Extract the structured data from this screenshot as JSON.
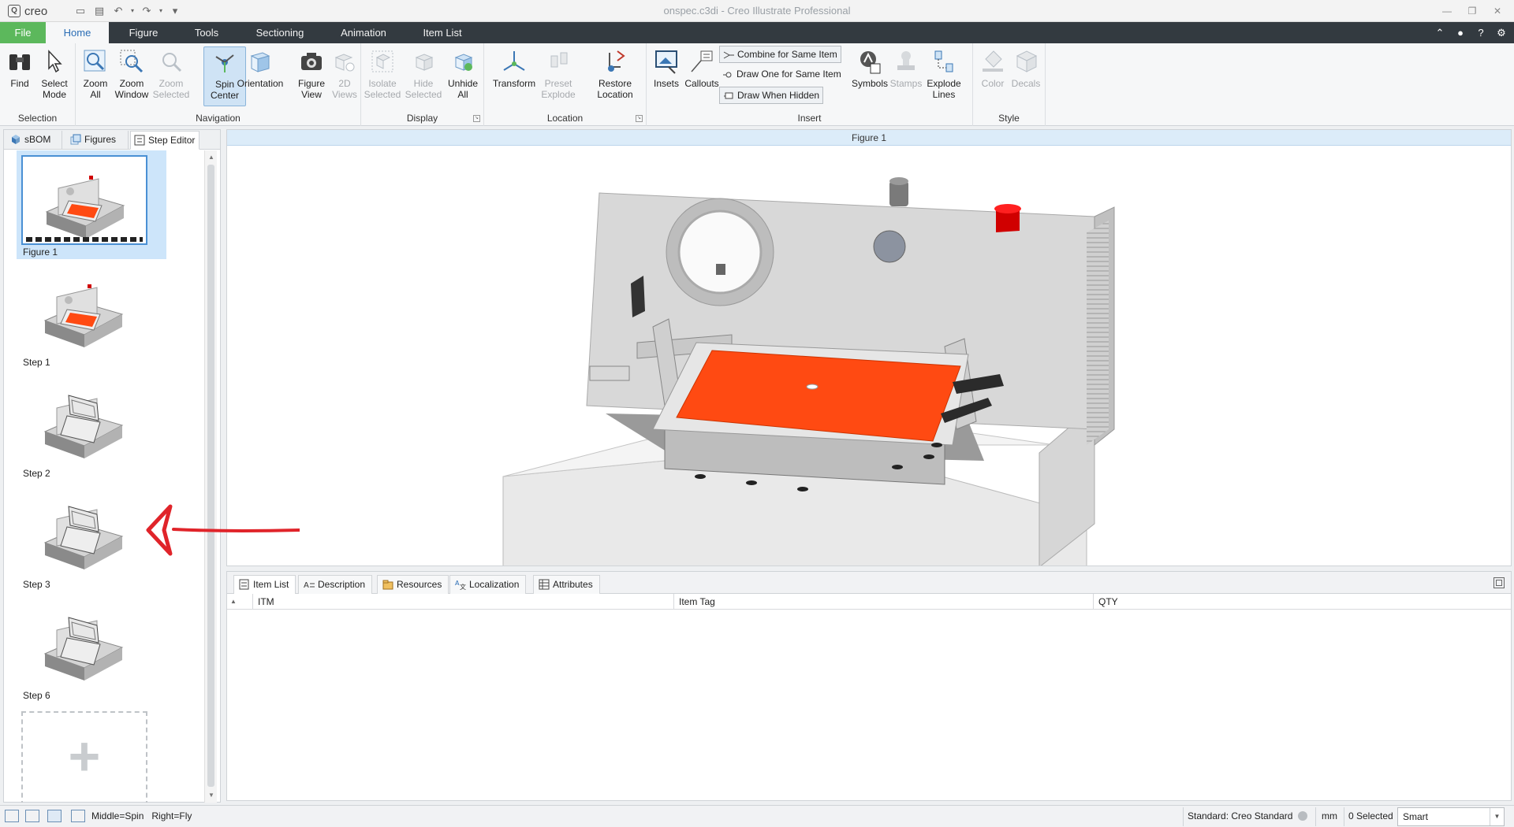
{
  "window": {
    "title": "onspec.c3di - Creo Illustrate Professional",
    "brand": "creo"
  },
  "menu": {
    "file": "File",
    "tabs": [
      "Home",
      "Figure",
      "Tools",
      "Sectioning",
      "Animation",
      "Item List"
    ]
  },
  "ribbon": {
    "find": "Find",
    "select_mode": "Select\nMode",
    "zoom_all": "Zoom\nAll",
    "zoom_window": "Zoom\nWindow",
    "zoom_selected": "Zoom\nSelected",
    "spin_center": "Spin\nCenter",
    "orientation": "Orientation",
    "figure_view": "Figure\nView",
    "views_2d": "2D\nViews",
    "isolate_selected": "Isolate\nSelected",
    "hide_selected": "Hide\nSelected",
    "unhide_all": "Unhide\nAll",
    "transform": "Transform",
    "preset_explode": "Preset\nExplode",
    "restore_location": "Restore\nLocation",
    "insets": "Insets",
    "callouts": "Callouts",
    "combine_for_same_item": "Combine for Same Item",
    "draw_one_for_same_item": "Draw One for Same Item",
    "draw_when_hidden": "Draw When Hidden",
    "symbols": "Symbols",
    "stamps": "Stamps",
    "explode_lines": "Explode\nLines",
    "color": "Color",
    "decals": "Decals",
    "groups": {
      "selection": "Selection",
      "navigation": "Navigation",
      "display": "Display",
      "location": "Location",
      "insert": "Insert",
      "style": "Style"
    }
  },
  "left_panel": {
    "tabs": [
      "sBOM",
      "Figures",
      "Step Editor"
    ],
    "steps": [
      {
        "label": "Figure 1"
      },
      {
        "label": "Step 1"
      },
      {
        "label": "Step 2"
      },
      {
        "label": "Step 3"
      },
      {
        "label": "Step 6"
      }
    ],
    "add_symbol": "+"
  },
  "viewport": {
    "header": "Figure 1"
  },
  "bottom_panel": {
    "tabs": [
      "Item List",
      "Description",
      "Resources",
      "Localization",
      "Attributes"
    ],
    "columns": [
      "ITM",
      "Item Tag",
      "QTY"
    ]
  },
  "status": {
    "mouse_hint": "Middle=Spin   Right=Fly",
    "standard": "Standard: Creo Standard",
    "units": "mm",
    "selected": "0 Selected",
    "filter": "Smart"
  },
  "colors": {
    "menu_bg": "#333a40",
    "file_tab": "#5cb85c",
    "accent_blue": "#2a6db5",
    "highlight": "#cde5fa",
    "model_orange": "#ff4a12",
    "annotation_red": "#e0242a"
  }
}
